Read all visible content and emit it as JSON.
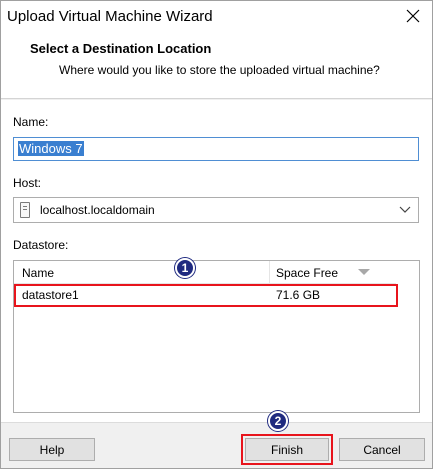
{
  "window": {
    "title": "Upload Virtual Machine Wizard"
  },
  "header": {
    "title": "Select a Destination Location",
    "subtitle": "Where would you like to store the uploaded virtual machine?"
  },
  "form": {
    "name_label": "Name:",
    "name_value": "Windows 7",
    "host_label": "Host:",
    "host_value": "localhost.localdomain",
    "datastore_label": "Datastore:"
  },
  "datastore_table": {
    "columns": [
      "Name",
      "Space Free"
    ],
    "rows": [
      {
        "name": "datastore1",
        "space_free": "71.6 GB"
      }
    ]
  },
  "annotations": {
    "badge_1": "1",
    "badge_2": "2",
    "highlight_color": "#e8141c",
    "badge_color": "#1f2a80"
  },
  "buttons": {
    "help": "Help",
    "finish": "Finish",
    "cancel": "Cancel"
  },
  "icons": {
    "close": "close-icon",
    "host": "server-icon",
    "dropdown": "chevron-down-icon",
    "sort": "sort-descending-icon"
  }
}
